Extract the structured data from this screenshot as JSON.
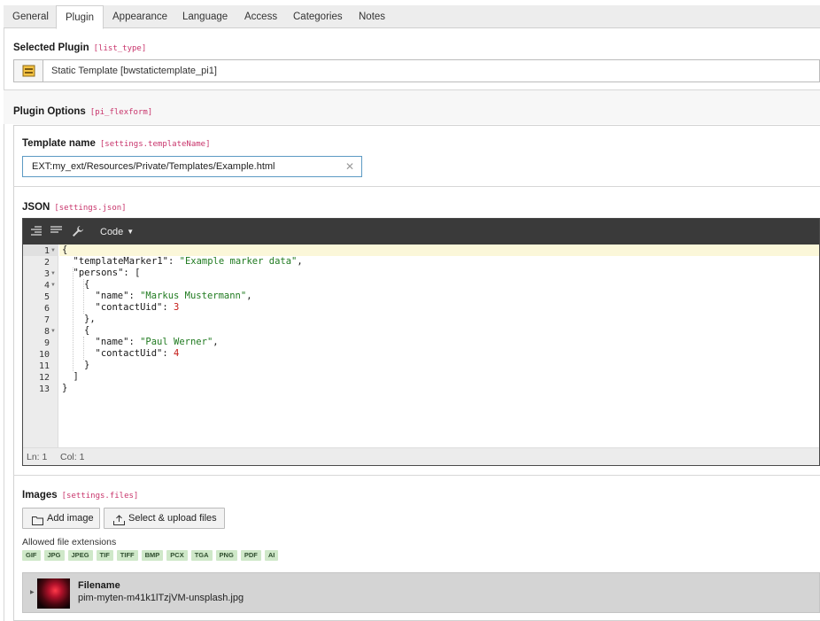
{
  "tabs": [
    {
      "label": "General"
    },
    {
      "label": "Plugin"
    },
    {
      "label": "Appearance"
    },
    {
      "label": "Language"
    },
    {
      "label": "Access"
    },
    {
      "label": "Categories"
    },
    {
      "label": "Notes"
    }
  ],
  "active_tab": "Plugin",
  "selected_plugin": {
    "label": "Selected Plugin",
    "key": "[list_type]",
    "value": "Static Template [bwstatictemplate_pi1]",
    "icon": "plugin-icon"
  },
  "plugin_options": {
    "label": "Plugin Options",
    "key": "[pi_flexform]"
  },
  "template_name": {
    "label": "Template name",
    "key": "[settings.templateName]",
    "value": "EXT:my_ext/Resources/Private/Templates/Example.html",
    "clear_icon": "close-icon"
  },
  "json_field": {
    "label": "JSON",
    "key": "[settings.json]",
    "toolbar": {
      "code_label": "Code",
      "icons": [
        "indent-icon",
        "align-icon",
        "wrench-icon",
        "caret-down-icon"
      ]
    },
    "line_numbers": [
      "1",
      "2",
      "3",
      "4",
      "5",
      "6",
      "7",
      "8",
      "9",
      "10",
      "11",
      "12",
      "13"
    ],
    "lines": [
      {
        "text": "{"
      },
      {
        "key": "\"templateMarker1\"",
        "sep": ": ",
        "str": "\"Example marker data\"",
        "end": ","
      },
      {
        "key": "\"persons\"",
        "sep": ": ",
        "end": "["
      },
      {
        "text": "{"
      },
      {
        "key": "\"name\"",
        "sep": ": ",
        "str": "\"Markus Mustermann\"",
        "end": ","
      },
      {
        "key": "\"contactUid\"",
        "sep": ": ",
        "num": "3"
      },
      {
        "text": "},"
      },
      {
        "text": "{"
      },
      {
        "key": "\"name\"",
        "sep": ": ",
        "str": "\"Paul Werner\"",
        "end": ","
      },
      {
        "key": "\"contactUid\"",
        "sep": ": ",
        "num": "4"
      },
      {
        "text": "}"
      },
      {
        "text": "]"
      },
      {
        "text": "}"
      }
    ],
    "status": {
      "ln": "Ln: 1",
      "col": "Col: 1"
    }
  },
  "images": {
    "label": "Images",
    "key": "[settings.files]",
    "add_button": "Add image",
    "upload_button": "Select & upload files",
    "allowed_label": "Allowed file extensions",
    "extensions": [
      "GIF",
      "JPG",
      "JPEG",
      "TIF",
      "TIFF",
      "BMP",
      "PCX",
      "TGA",
      "PNG",
      "PDF",
      "AI"
    ],
    "file": {
      "title": "Filename",
      "name": "pim-myten-m41k1lTzjVM-unsplash.jpg"
    }
  }
}
